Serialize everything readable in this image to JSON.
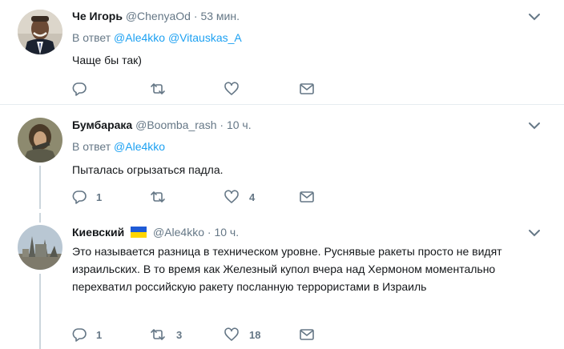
{
  "tweets": [
    {
      "name": "Че Игорь",
      "handle": "@ChenyaOd",
      "separator": "·",
      "time": "53 мин.",
      "reply_prefix": "В ответ",
      "mentions": [
        "@Ale4kko",
        "@Vitauskas_A"
      ],
      "text": "Чаще бы так)",
      "counts": {
        "reply": "",
        "retweet": "",
        "like": ""
      }
    },
    {
      "name": "Бумбарака",
      "handle": "@Boomba_rash",
      "separator": "·",
      "time": "10 ч.",
      "reply_prefix": "В ответ",
      "mentions": [
        "@Ale4kko"
      ],
      "text": "Пыталась огрызаться падла.",
      "counts": {
        "reply": "1",
        "retweet": "",
        "like": "4"
      }
    },
    {
      "name": "Киевский",
      "handle": "@Ale4kko",
      "separator": "·",
      "time": "10 ч.",
      "flag_icon": "ukraine-flag-icon",
      "text": "Это называется разница в техническом уровне. Руснявые ракеты просто не видят израильских. В то время как Железный купол вчера над Хермоном моментально перехватил российскую ракету посланную террористами в Израиль",
      "counts": {
        "reply": "1",
        "retweet": "3",
        "like": "18"
      }
    }
  ],
  "colors": {
    "link": "#1da1f2",
    "secondary": "#657786",
    "divider": "#e6ecf0",
    "thread_line": "#ccd6dd",
    "flag_blue": "#1f5bd6",
    "flag_yellow": "#ffd500"
  },
  "icons": [
    "reply-icon",
    "retweet-icon",
    "like-icon",
    "direct-message-icon",
    "chevron-down-icon"
  ]
}
